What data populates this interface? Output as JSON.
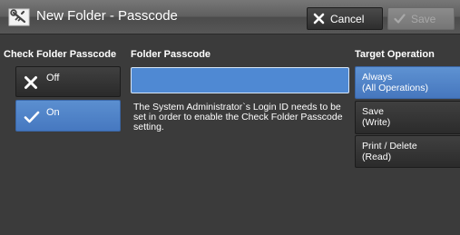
{
  "header": {
    "title": "New Folder - Passcode",
    "title_icon": "folder-key-icon",
    "cancel_label": "Cancel",
    "cancel_icon": "x-icon",
    "save_label": "Save",
    "save_icon": "checkmark-icon"
  },
  "check_folder_passcode": {
    "label": "Check Folder Passcode",
    "options": [
      {
        "label": "Off",
        "icon": "x-icon",
        "selected": false
      },
      {
        "label": "On",
        "icon": "checkmark-icon",
        "selected": true
      }
    ]
  },
  "folder_passcode": {
    "label": "Folder Passcode",
    "value": "",
    "info_text": "The System Administrator`s Login ID needs to be set in order to enable the Check Folder Passcode setting."
  },
  "target_operation": {
    "label": "Target Operation",
    "options": [
      {
        "line1": "Always",
        "line2": "(All Operations)",
        "selected": true
      },
      {
        "line1": "Save",
        "line2": "(Write)",
        "selected": false
      },
      {
        "line1": "Print / Delete",
        "line2": "(Read)",
        "selected": false
      }
    ]
  },
  "colors": {
    "selected_blue": "#4a7cc4",
    "background": "#3b3b3b",
    "button_dark": "#333333"
  }
}
